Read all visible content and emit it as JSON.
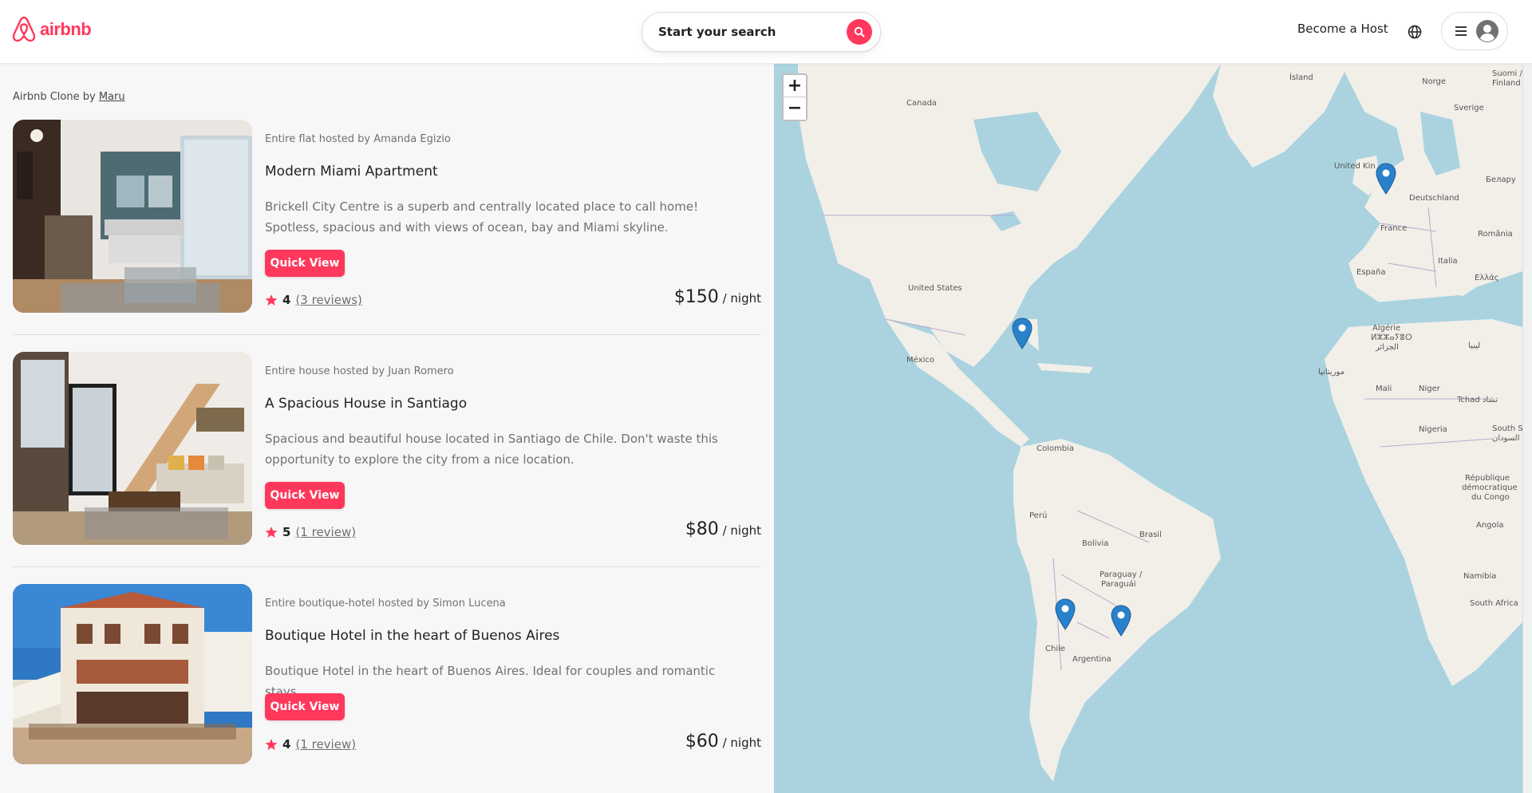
{
  "header": {
    "logo_text": "airbnb",
    "search_label": "Start your search",
    "host_link": "Become a Host"
  },
  "credit": {
    "prefix": "Airbnb Clone by ",
    "author": "Maru"
  },
  "listings": [
    {
      "subtitle": "Entire flat hosted by Amanda Egizio",
      "title": "Modern Miami Apartment",
      "description": "Brickell City Centre is a superb and centrally located place to call home! Spotless, spacious and with views of ocean, bay and Miami skyline.",
      "button": "Quick View",
      "rating": "4",
      "reviews": "(3 reviews)",
      "price": "$150",
      "price_unit": " / night"
    },
    {
      "subtitle": "Entire house hosted by Juan Romero",
      "title": "A Spacious House in Santiago",
      "description": "Spacious and beautiful house located in Santiago de Chile. Don't waste this opportunity to explore the city from a nice location.",
      "button": "Quick View",
      "rating": "5",
      "reviews": "(1 review)",
      "price": "$80",
      "price_unit": " / night"
    },
    {
      "subtitle": "Entire boutique-hotel hosted by Simon Lucena",
      "title": "Boutique Hotel in the heart of Buenos Aires",
      "description": "Boutique Hotel in the heart of Buenos Aires. Ideal for couples and romantic stays.",
      "button": "Quick View",
      "rating": "4",
      "reviews": "(1 review)",
      "price": "$60",
      "price_unit": " / night"
    }
  ],
  "map": {
    "zoom_in": "+",
    "zoom_out": "−",
    "labels": {
      "canada": "Canada",
      "united_states": "United States",
      "mexico": "México",
      "colombia": "Colombia",
      "peru": "Perú",
      "bolivia": "Bolivia",
      "brasil": "Brasil",
      "paraguay": "Paraguay /",
      "paraguay2": "Paraguái",
      "chile": "Chile",
      "argentina": "Argentina",
      "island": "Ísland",
      "norge": "Norge",
      "sverige": "Sverige",
      "suomi": "Suomi /",
      "finland": "Finland",
      "uk": "United Kin",
      "deutschland": "Deutschland",
      "belarus": "Беларy",
      "france": "France",
      "romania": "România",
      "espana": "España",
      "italia": "Italia",
      "ellas": "Ελλάς",
      "algerie": "Algérie",
      "algerie2": "ⵍⵣⵣⴰⵢⴻⵔ",
      "algerie3": "الجزائر",
      "libya": "ليبيا",
      "mauritania": "موريتانيا",
      "mali": "Mali",
      "niger": "Niger",
      "tchad": "Tchad تشاد",
      "nigeria": "Nigeria",
      "south_sudan": "South S",
      "south_sudan2": "جنوب السودان",
      "congo": "République",
      "congo2": "démocratique",
      "congo3": "du Congo",
      "angola": "Angola",
      "namibia": "Namibia",
      "south_africa": "South Africa"
    }
  },
  "colors": {
    "brand": "#ff385c",
    "marker": "#2a81cb",
    "water": "#aad3df",
    "land": "#f2efe9"
  }
}
